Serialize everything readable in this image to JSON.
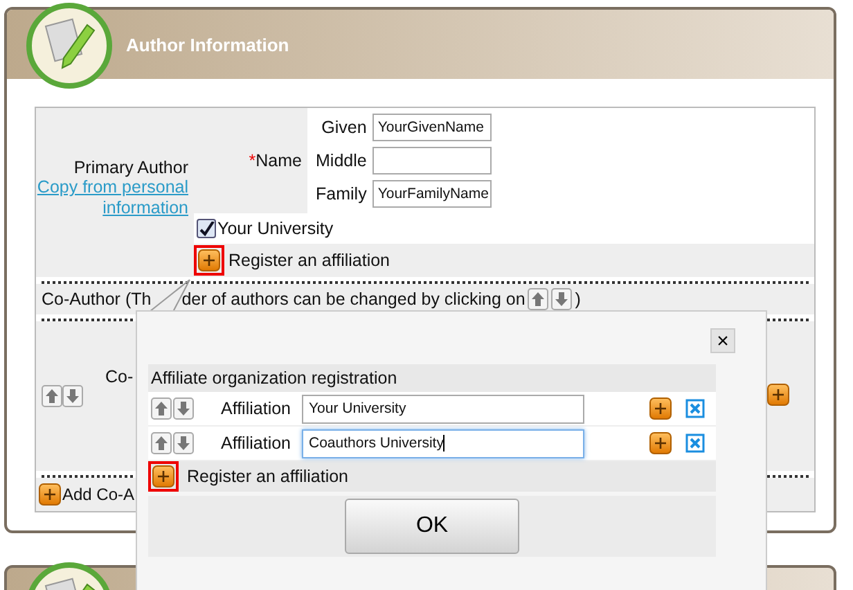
{
  "panel": {
    "title": "Author Information"
  },
  "primary_author": {
    "label": "Primary Author",
    "copy_link": "Copy from personal information",
    "required_mark": "*",
    "name_label": "Name",
    "name_fields": [
      {
        "label": "Given",
        "value": "YourGivenName"
      },
      {
        "label": "Middle"
      },
      {
        "label": "Family",
        "value": "YourFamilyName"
      }
    ],
    "affiliations": [
      {
        "label": "Your University",
        "checked": true
      }
    ],
    "register_button": "Register an affiliation"
  },
  "co_author": {
    "heading_start": "Co-Author (Th",
    "heading_middle": "der of authors can be changed by clicking on",
    "heading_end": ")",
    "label": "Co-",
    "add_button": "Add Co-A"
  },
  "dialog": {
    "close": "×",
    "title": "Affiliate organization registration",
    "rows": [
      {
        "label": "Affiliation",
        "value": "Your University",
        "focused": false
      },
      {
        "label": "Affiliation",
        "value": "Coauthors University",
        "focused": true
      }
    ],
    "register_button": "Register an affiliation",
    "ok": "OK"
  }
}
